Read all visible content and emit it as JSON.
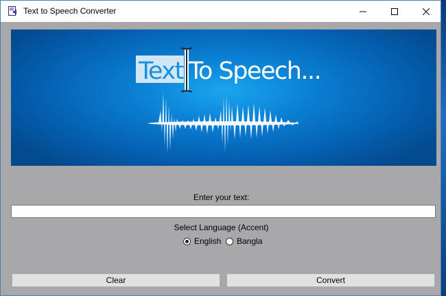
{
  "window": {
    "title": "Text to Speech Converter"
  },
  "banner": {
    "highlighted_word": "Text",
    "rest_text": "To Speech..."
  },
  "form": {
    "enter_label": "Enter your text:",
    "text_value": "",
    "language_label": "Select Language (Accent)",
    "options": [
      {
        "label": "English",
        "selected": true
      },
      {
        "label": "Bangla",
        "selected": false
      }
    ]
  },
  "buttons": {
    "clear_label": "Clear",
    "convert_label": "Convert"
  },
  "colors": {
    "window_bg": "#a8a8ab",
    "banner_blue": "#0b7fd3",
    "highlight": "#cfe6f7"
  }
}
